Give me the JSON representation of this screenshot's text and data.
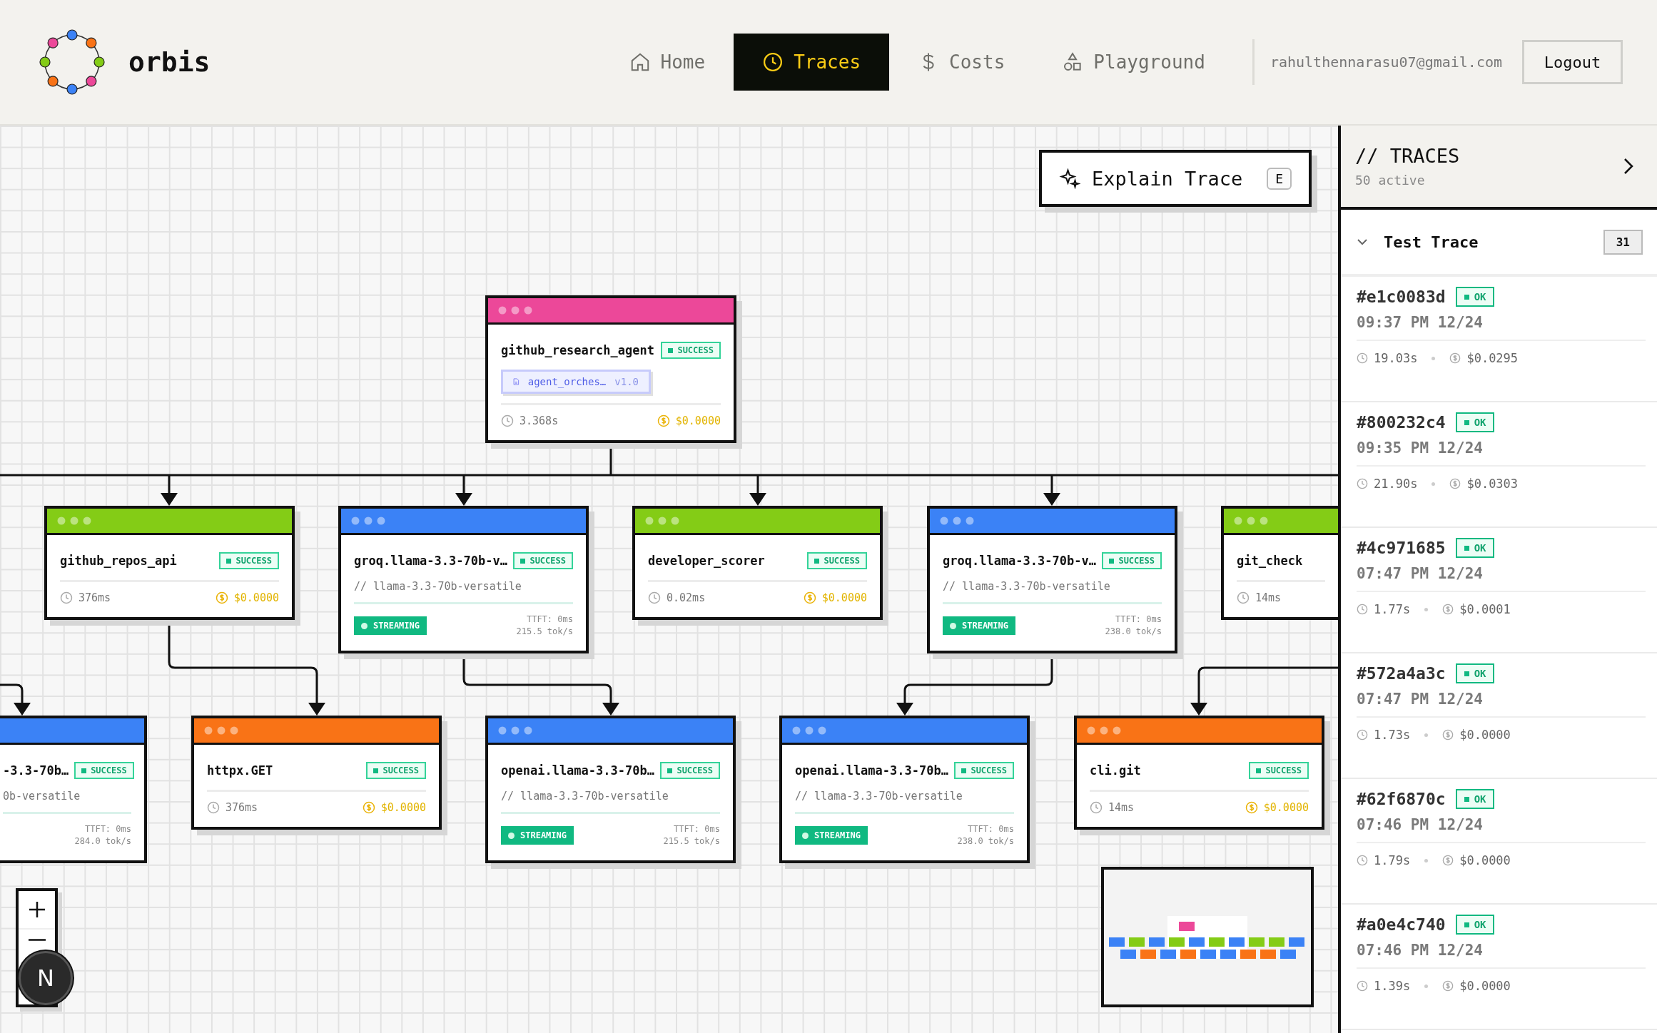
{
  "app": {
    "name": "orbis"
  },
  "nav": [
    {
      "label": "Home",
      "selected": false
    },
    {
      "label": "Traces",
      "selected": true
    },
    {
      "label": "Costs",
      "selected": false
    },
    {
      "label": "Playground",
      "selected": false
    }
  ],
  "user": {
    "email": "rahulthennarasu07@gmail.com",
    "logout": "Logout"
  },
  "canvas": {
    "explain_button": {
      "label": "Explain Trace",
      "shortcut": "E"
    },
    "root": {
      "kind": "agent",
      "name": "github_research_agent",
      "status": "SUCCESS",
      "color": "#ec4899",
      "prompt": "agent_orches…",
      "version": "v1.0",
      "duration": "3.368s",
      "cost": "$0.0000"
    },
    "row_1": [
      {
        "kind": "tool",
        "name": "github_repos_api",
        "status": "SUCCESS",
        "color": "#84cc16",
        "duration": "376ms",
        "cost": "$0.0000"
      },
      {
        "kind": "llm",
        "name": "groq.llama-3.3-70b-v…",
        "status": "SUCCESS",
        "color": "#3b82f6",
        "model": "// llama-3.3-70b-versatile",
        "streaming": "STREAMING",
        "ttft": "TTFT: 0ms",
        "rate": "215.5 tok/s"
      },
      {
        "kind": "tool",
        "name": "developer_scorer",
        "status": "SUCCESS",
        "color": "#84cc16",
        "duration": "0.02ms",
        "cost": "$0.0000"
      },
      {
        "kind": "llm",
        "name": "groq.llama-3.3-70b-v…",
        "status": "SUCCESS",
        "color": "#3b82f6",
        "model": "// llama-3.3-70b-versatile",
        "streaming": "STREAMING",
        "ttft": "TTFT: 0ms",
        "rate": "238.0 tok/s"
      },
      {
        "kind": "tool",
        "name": "git_check",
        "color": "#84cc16",
        "duration": "14ms",
        "cut_right": true
      }
    ],
    "row_2": [
      {
        "kind": "llm",
        "name": "-3.3-70b…",
        "status": "SUCCESS",
        "color": "#3b82f6",
        "model": "0b-versatile",
        "ttft": "TTFT: 0ms",
        "rate": "284.0 tok/s",
        "cut_left": true
      },
      {
        "kind": "tool",
        "name": "httpx.GET",
        "status": "SUCCESS",
        "color": "#f97316",
        "duration": "376ms",
        "cost": "$0.0000"
      },
      {
        "kind": "llm",
        "name": "openai.llama-3.3-70b…",
        "status": "SUCCESS",
        "color": "#3b82f6",
        "model": "// llama-3.3-70b-versatile",
        "streaming": "STREAMING",
        "ttft": "TTFT: 0ms",
        "rate": "215.5 tok/s"
      },
      {
        "kind": "llm",
        "name": "openai.llama-3.3-70b…",
        "status": "SUCCESS",
        "color": "#3b82f6",
        "model": "// llama-3.3-70b-versatile",
        "streaming": "STREAMING",
        "ttft": "TTFT: 0ms",
        "rate": "238.0 tok/s"
      },
      {
        "kind": "tool",
        "name": "cli.git",
        "status": "SUCCESS",
        "color": "#f97316",
        "duration": "14ms",
        "cost": "$0.0000"
      }
    ],
    "dev_badge": "N"
  },
  "sidebar": {
    "title": "// TRACES",
    "subtitle": "50 active",
    "group": {
      "name": "Test Trace",
      "count": "31",
      "expanded": true
    },
    "traces": [
      {
        "id": "#e1c0083d",
        "status": "OK",
        "time": "09:37 PM 12/24",
        "duration": "19.03s",
        "cost": "$0.0295"
      },
      {
        "id": "#800232c4",
        "status": "OK",
        "time": "09:35 PM 12/24",
        "duration": "21.90s",
        "cost": "$0.0303"
      },
      {
        "id": "#4c971685",
        "status": "OK",
        "time": "07:47 PM 12/24",
        "duration": "1.77s",
        "cost": "$0.0001"
      },
      {
        "id": "#572a4a3c",
        "status": "OK",
        "time": "07:47 PM 12/24",
        "duration": "1.73s",
        "cost": "$0.0000"
      },
      {
        "id": "#62f6870c",
        "status": "OK",
        "time": "07:46 PM 12/24",
        "duration": "1.79s",
        "cost": "$0.0000"
      },
      {
        "id": "#a0e4c740",
        "status": "OK",
        "time": "07:46 PM 12/24",
        "duration": "1.39s",
        "cost": "$0.0000"
      }
    ]
  }
}
